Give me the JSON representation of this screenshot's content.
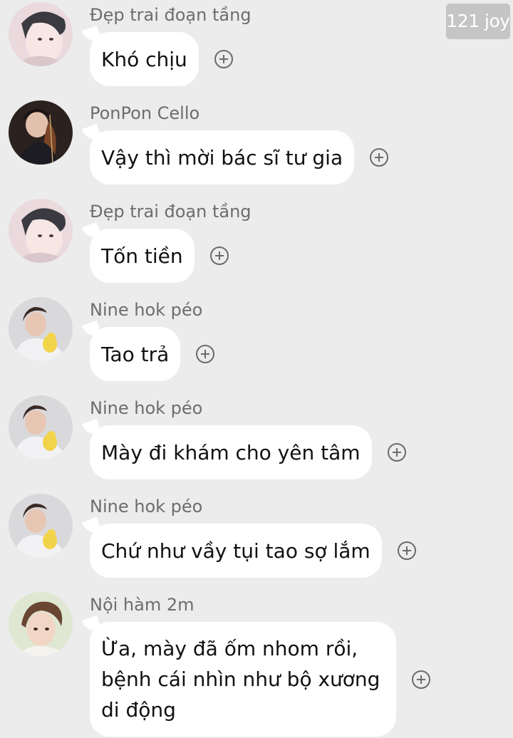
{
  "watermark": "121 joy",
  "messages": [
    {
      "sender": "Đẹp trai đoạn tầng",
      "text": "Khó chịu",
      "avatar_icon": "boy-pale-avatar-icon"
    },
    {
      "sender": "PonPon Cello",
      "text": "Vậy thì mời bác sĩ tư gia",
      "avatar_icon": "cello-player-avatar-icon"
    },
    {
      "sender": "Đẹp trai đoạn tầng",
      "text": "Tốn tiền",
      "avatar_icon": "boy-pale-avatar-icon"
    },
    {
      "sender": "Nine hok péo",
      "text": "Tao trả",
      "avatar_icon": "boy-duck-avatar-icon"
    },
    {
      "sender": "Nine hok péo",
      "text": "Mày đi khám cho yên tâm",
      "avatar_icon": "boy-duck-avatar-icon"
    },
    {
      "sender": "Nine hok péo",
      "text": "Chứ như vầy tụi tao sợ lắm",
      "avatar_icon": "boy-duck-avatar-icon"
    },
    {
      "sender": "Nội hàm 2m",
      "text": "Ừa, mày đã ốm nhom rồi, bệnh cái nhìn như bộ xương di động",
      "avatar_icon": "boy-brown-hair-avatar-icon"
    }
  ],
  "colors": {
    "background": "#ececec",
    "bubble": "#ffffff",
    "sender_text": "#6d6d6d",
    "message_text": "#111111"
  }
}
